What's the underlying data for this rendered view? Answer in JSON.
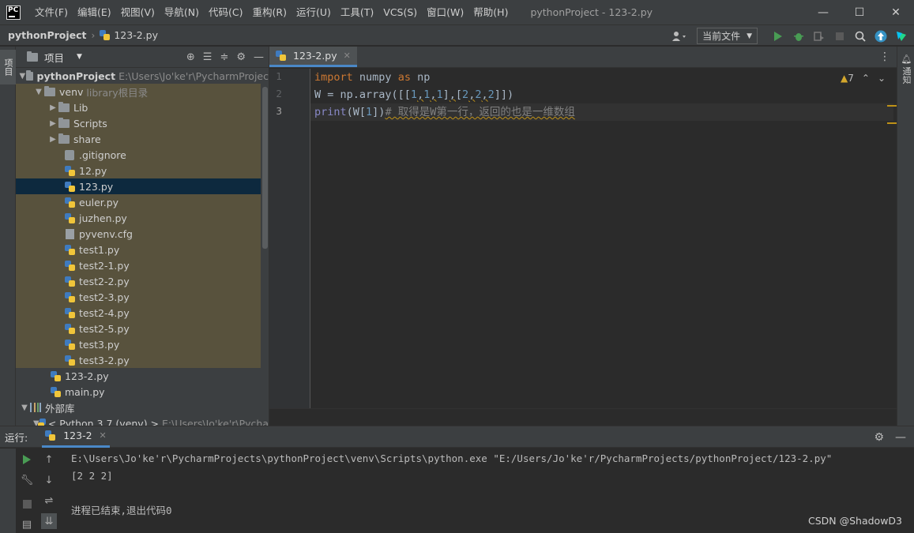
{
  "app": {
    "logo_text": "PC",
    "window_title": "pythonProject - 123-2.py",
    "menu": [
      "文件(F)",
      "编辑(E)",
      "视图(V)",
      "导航(N)",
      "代码(C)",
      "重构(R)",
      "运行(U)",
      "工具(T)",
      "VCS(S)",
      "窗口(W)",
      "帮助(H)"
    ],
    "controls": {
      "minimize": "—",
      "maximize": "☐",
      "close": "✕"
    }
  },
  "navbar": {
    "project": "pythonProject",
    "file": "123-2.py",
    "run_config": "当前文件"
  },
  "left_strip": {
    "project_tab": "项目"
  },
  "right_strip": {
    "notifications_tab": "通知"
  },
  "project_panel": {
    "title": "项目",
    "tree": [
      {
        "label": "pythonProject",
        "hint": "E:\\Users\\Jo'ke'r\\PycharmProjec"
      },
      {
        "label": "venv",
        "hint": "library根目录"
      },
      {
        "label": "Lib"
      },
      {
        "label": "Scripts"
      },
      {
        "label": "share"
      },
      {
        "label": ".gitignore"
      },
      {
        "label": "12.py"
      },
      {
        "label": "123.py"
      },
      {
        "label": "euler.py"
      },
      {
        "label": "juzhen.py"
      },
      {
        "label": "pyvenv.cfg"
      },
      {
        "label": "test1.py"
      },
      {
        "label": "test2-1.py"
      },
      {
        "label": "test2-2.py"
      },
      {
        "label": "test2-3.py"
      },
      {
        "label": "test2-4.py"
      },
      {
        "label": "test2-5.py"
      },
      {
        "label": "test3.py"
      },
      {
        "label": "test3-2.py"
      },
      {
        "label": "123-2.py"
      },
      {
        "label": "main.py"
      },
      {
        "label": "外部库"
      },
      {
        "label": "< Python 3.7 (venv) >",
        "hint": "E:\\Users\\Jo'ke'r\\Pycha"
      }
    ]
  },
  "editor": {
    "tab_label": "123-2.py",
    "line_numbers": [
      "1",
      "2",
      "3"
    ],
    "warnings_count": "7",
    "lines": {
      "l1": {
        "kw1": "import",
        "mod": " numpy ",
        "kw2": "as",
        "alias": " np"
      },
      "l2": {
        "a": "W = np.array([[",
        "n1": "1",
        "c1": ",",
        "n2": "1",
        "c2": ",",
        "n3": "1",
        "b1": "]",
        "c3": ",",
        "b2": "[",
        "n4": "2",
        "c4": ",",
        "n5": "2",
        "c5": ",",
        "n6": "2",
        "end": "]])"
      },
      "l3": {
        "fn": "print",
        "args": "(W[",
        "n": "1",
        "close": "])",
        "comment": "# 取得是W第一行，返回的也是一维数组"
      }
    }
  },
  "run_panel": {
    "label": "运行:",
    "tab": "123-2",
    "console": [
      "E:\\Users\\Jo'ke'r\\PycharmProjects\\pythonProject\\venv\\Scripts\\python.exe \"E:/Users/Jo'ke'r/PycharmProjects/pythonProject/123-2.py\"",
      "[2 2 2]",
      "",
      "进程已结束,退出代码0"
    ]
  },
  "watermark": "CSDN @ShadowD3",
  "colors": {
    "accent": "#4a88c7",
    "keyword": "#cc7832",
    "number": "#6897bb",
    "comment": "#808080",
    "builtin": "#8888c6",
    "selection": "#0d293e",
    "venv_bg": "#58523d"
  }
}
